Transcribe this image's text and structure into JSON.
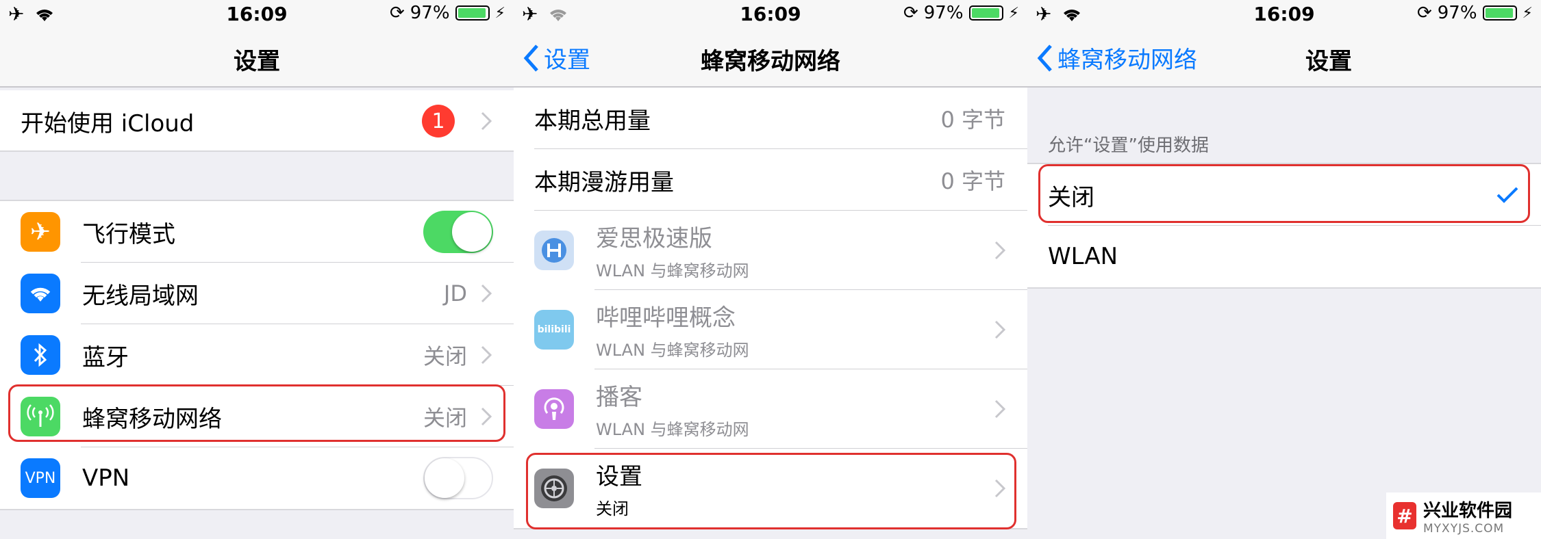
{
  "status": {
    "time": "16:09",
    "battery": "97%"
  },
  "panel1": {
    "title": "设置",
    "icloud": {
      "label": "开始使用 iCloud",
      "badge": "1"
    },
    "rows": [
      {
        "label": "飞行模式"
      },
      {
        "label": "无线局域网",
        "value": "JD"
      },
      {
        "label": "蓝牙",
        "value": "关闭"
      },
      {
        "label": "蜂窝移动网络",
        "value": "关闭"
      },
      {
        "label": "VPN",
        "icon_text": "VPN"
      }
    ]
  },
  "panel2": {
    "back": "设置",
    "title": "蜂窝移动网络",
    "usage": [
      {
        "label": "本期总用量",
        "value": "0 字节"
      },
      {
        "label": "本期漫游用量",
        "value": "0 字节"
      }
    ],
    "apps": [
      {
        "name": "爱思极速版",
        "sub": "WLAN 与蜂窝移动网"
      },
      {
        "name": "哔哩哔哩概念",
        "sub": "WLAN 与蜂窝移动网",
        "icon_text": "bilibili"
      },
      {
        "name": "播客",
        "sub": "WLAN 与蜂窝移动网"
      },
      {
        "name": "设置",
        "sub": "关闭"
      }
    ]
  },
  "panel3": {
    "back": "蜂窝移动网络",
    "title": "设置",
    "section": "允许“设置”使用数据",
    "options": [
      {
        "label": "关闭",
        "selected": true
      },
      {
        "label": "WLAN",
        "selected": false
      }
    ]
  },
  "watermark": {
    "logo": "#",
    "name": "兴业软件园",
    "url": "MYXYJS.COM"
  },
  "colors": {
    "accent": "#0a7aff",
    "toggle_on": "#4cd964",
    "badge": "#ff3b30",
    "highlight": "#e0302e",
    "airplane": "#ff9500",
    "wifi": "#0a7aff",
    "bluetooth": "#0a7aff",
    "cellular": "#4cd964",
    "vpn": "#0a7aff"
  }
}
